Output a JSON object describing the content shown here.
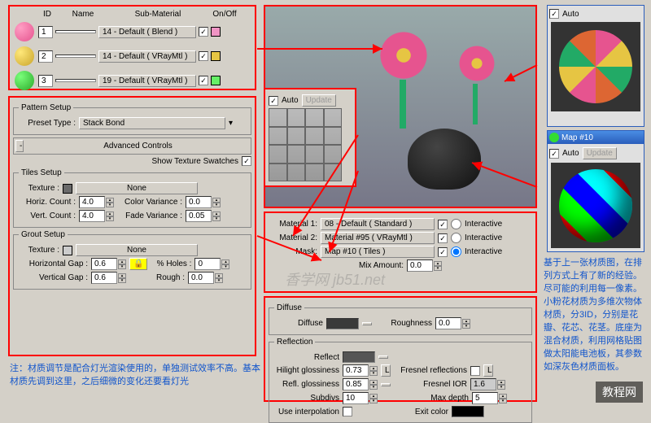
{
  "materials_list": {
    "headers": {
      "id": "ID",
      "name": "Name",
      "sub": "Sub-Material",
      "onoff": "On/Off"
    },
    "rows": [
      {
        "id": "1",
        "sub": "14 - Default  ( Blend )",
        "swatch": "#f094c4"
      },
      {
        "id": "2",
        "sub": "14 - Default  ( VRayMtl )",
        "swatch": "#e6c543"
      },
      {
        "id": "3",
        "sub": "19 - Default  ( VRayMtl )",
        "swatch": "#66f066"
      }
    ]
  },
  "pattern_setup": {
    "legend": "Pattern Setup",
    "preset_label": "Preset Type :",
    "preset_value": "Stack Bond"
  },
  "advanced": {
    "title": "Advanced Controls",
    "show_swatches": "Show Texture Swatches"
  },
  "tiles_setup": {
    "legend": "Tiles Setup",
    "texture": "Texture :",
    "none": "None",
    "horiz_count": "Horiz. Count :",
    "horiz_val": "4.0",
    "vert_count": "Vert. Count :",
    "vert_val": "4.0",
    "color_var": "Color Variance :",
    "color_val": "0.0",
    "fade_var": "Fade Variance :",
    "fade_val": "0.05"
  },
  "grout_setup": {
    "legend": "Grout Setup",
    "texture": "Texture :",
    "none": "None",
    "hgap": "Horizontal Gap :",
    "hgap_val": "0.6",
    "vgap": "Vertical Gap :",
    "vgap_val": "0.6",
    "holes": "% Holes :",
    "holes_val": "0",
    "rough": "Rough :",
    "rough_val": "0.0"
  },
  "preview": {
    "auto": "Auto",
    "update": "Update"
  },
  "blend": {
    "mat1_label": "Material 1:",
    "mat1_val": "08 - Default  ( Standard )",
    "mat2_label": "Material 2:",
    "mat2_val": "Material #95  ( VRayMtl )",
    "mask_label": "Mask:",
    "mask_val": "Map #10  ( Tiles )",
    "interactive": "Interactive",
    "mix_label": "Mix Amount:",
    "mix_val": "0.0"
  },
  "diffuse_section": {
    "legend": "Diffuse",
    "diffuse": "Diffuse",
    "roughness": "Roughness",
    "rough_val": "0.0"
  },
  "reflection_section": {
    "legend": "Reflection",
    "reflect": "Reflect",
    "hilight": "Hilight glossiness",
    "hilight_val": "0.73",
    "refl_gloss": "Refl. glossiness",
    "refl_val": "0.85",
    "subdivs": "Subdivs",
    "subdivs_val": "10",
    "use_interp": "Use interpolation",
    "fresnel_refl": "Fresnel reflections",
    "fresnel_ior": "Fresnel IOR",
    "fresnel_val": "1.6",
    "max_depth": "Max depth",
    "max_depth_val": "5",
    "exit_color": "Exit color",
    "L": "L"
  },
  "right_top": {
    "auto": "Auto"
  },
  "right_bottom": {
    "title": "Map #10",
    "auto": "Auto",
    "update": "Update"
  },
  "bottom_note": "注：材质调节是配合灯光渲染使用的，单独测试效率不高。基本材质先调到这里，之后细微的变化还要看灯光",
  "side_note": "基于上一张材质图，在排列方式上有了新的经验。尽可能的利用每一像素。小粉花材质为多维次物体材质，分3ID，分别是花瓣、花芯、花茎。底座为混合材质，利用网格贴图做太阳能电池板，其参数如深灰色材质面板。",
  "watermark1": "香学网 jb51.net",
  "watermark2": "教程网"
}
